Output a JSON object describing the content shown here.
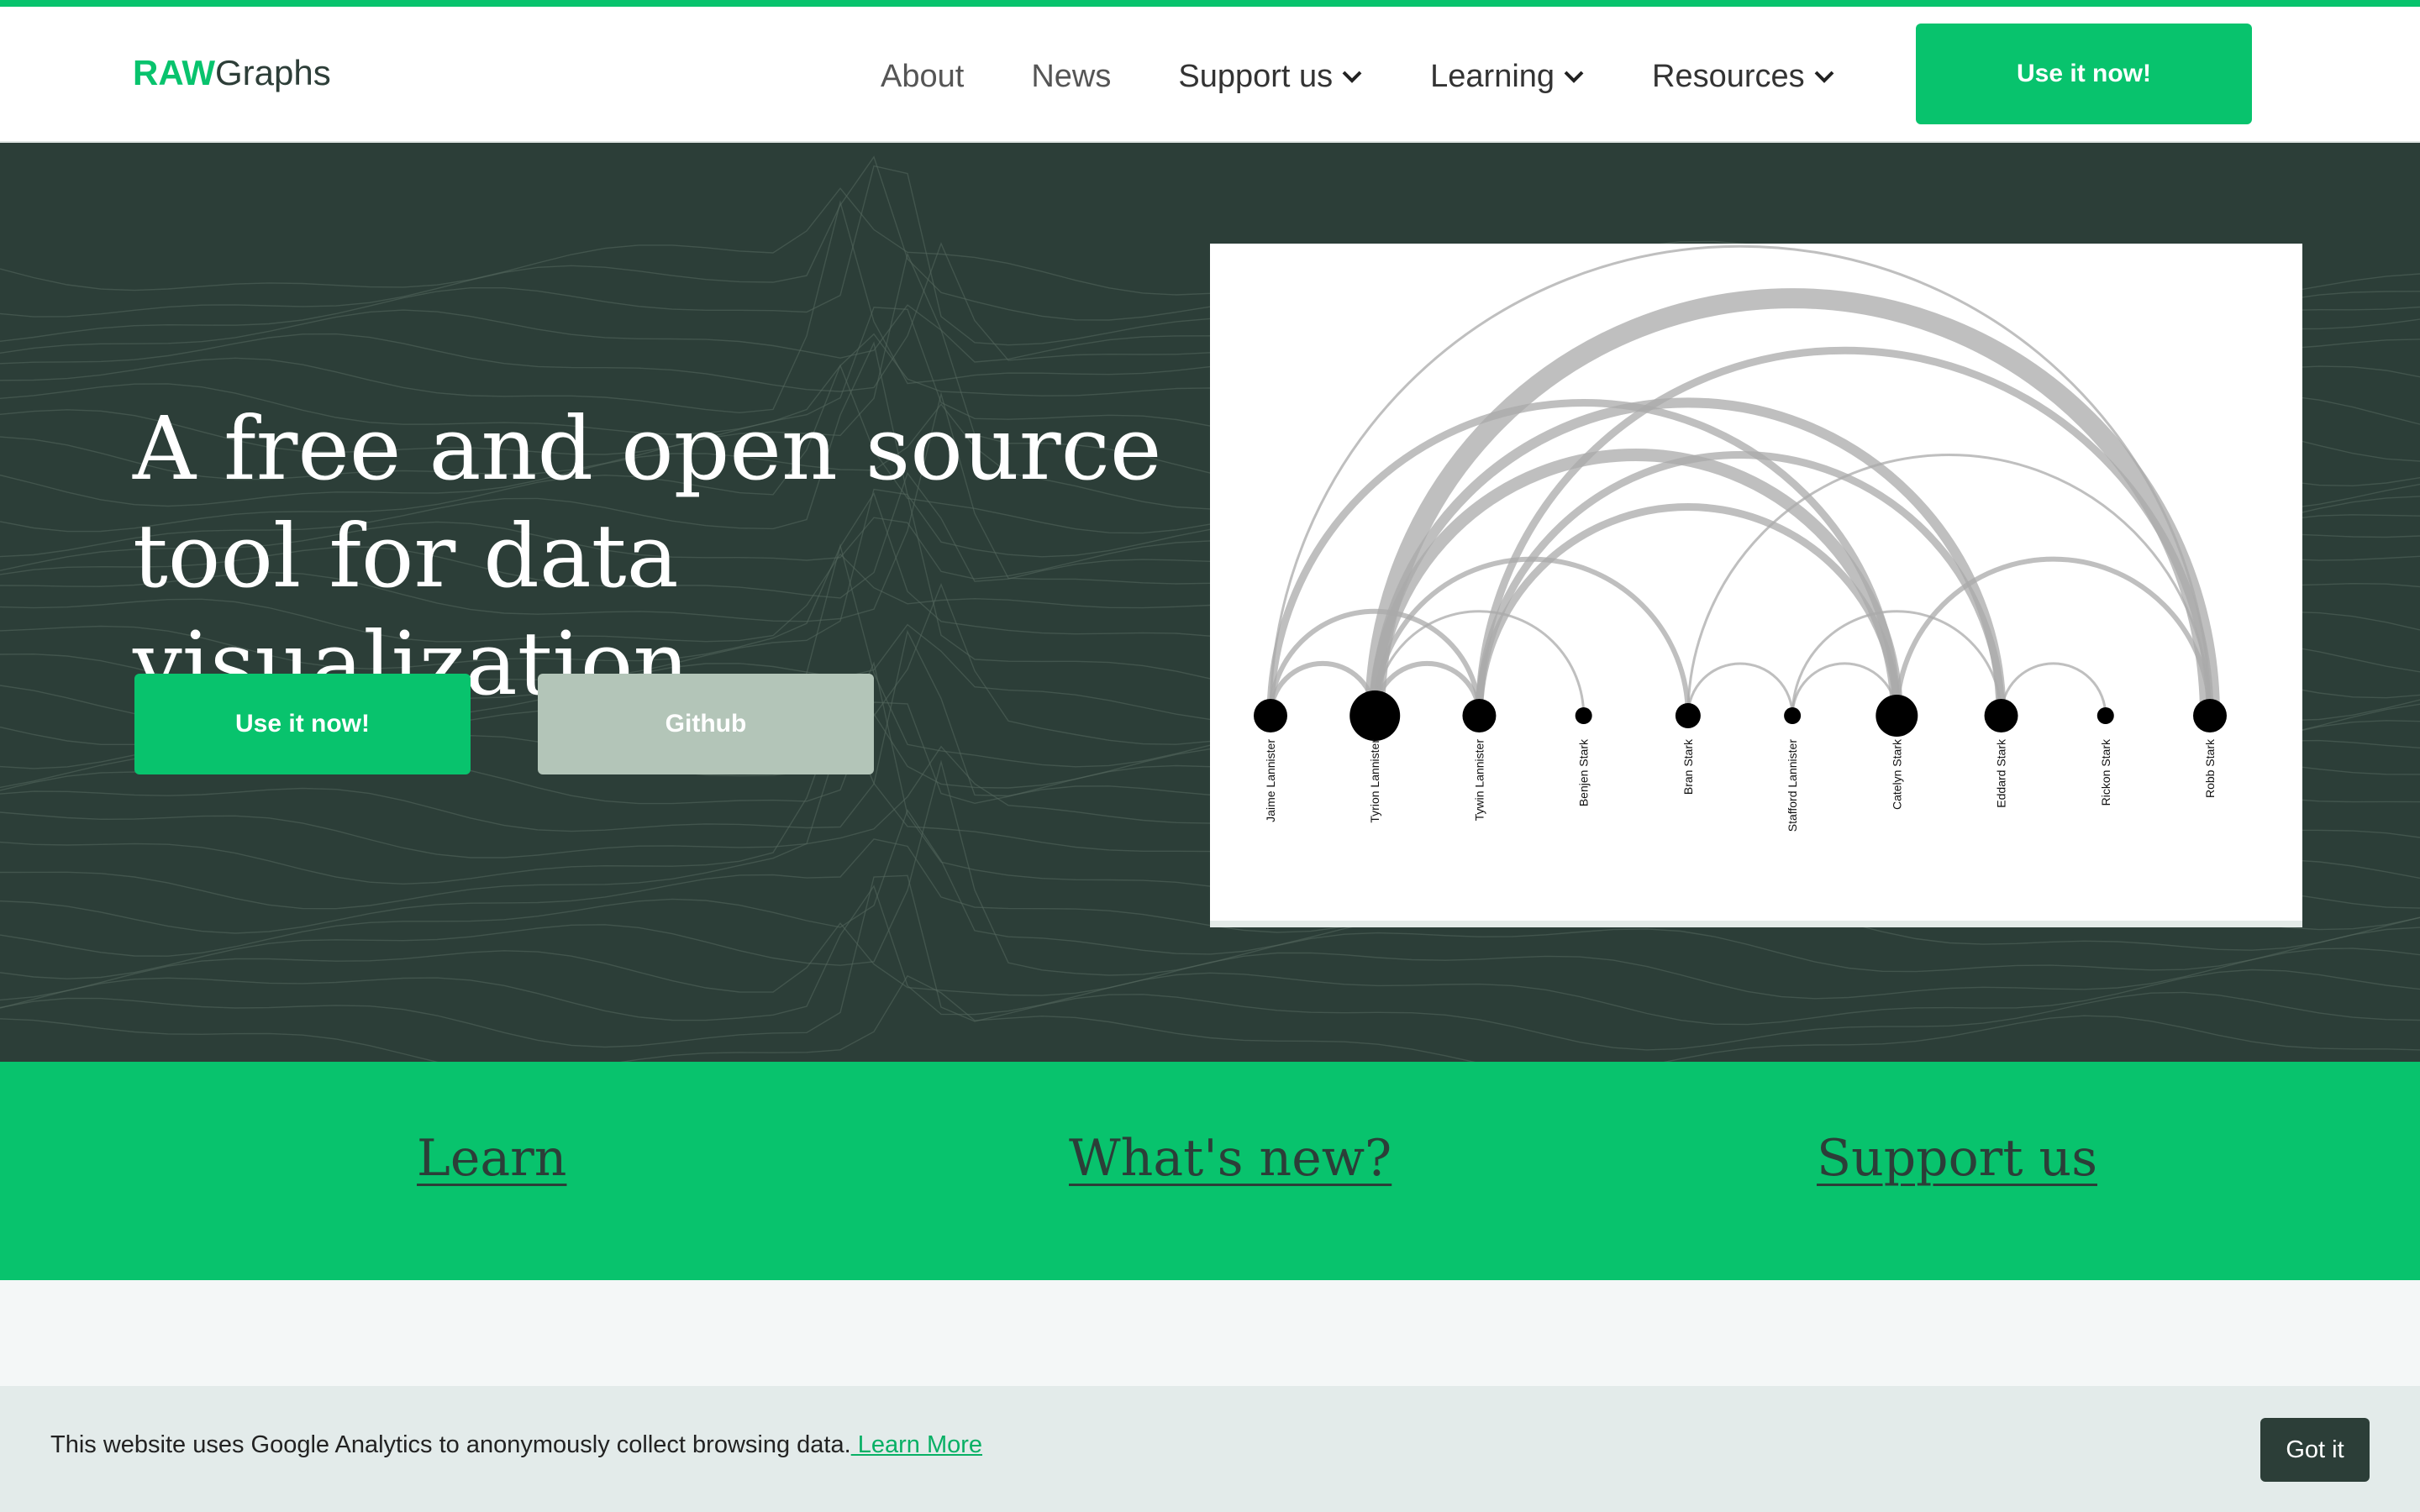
{
  "brand": {
    "logo_raw": "RAW",
    "logo_rest": "Graphs",
    "accent": "#08c36d",
    "dark": "#2c3e38"
  },
  "nav": {
    "about": "About",
    "news": "News",
    "support": "Support us",
    "learning": "Learning",
    "resources": "Resources",
    "cta": "Use it now!"
  },
  "hero": {
    "title_line1": "A free and open source",
    "title_line2": "tool for data visualization",
    "primary_btn": "Use it now!",
    "secondary_btn": "Github"
  },
  "chart_data": {
    "type": "arc",
    "nodes": [
      {
        "name": "Jaime Lannister",
        "size": 3
      },
      {
        "name": "Tyrion Lannister",
        "size": 5
      },
      {
        "name": "Tywin Lannister",
        "size": 3
      },
      {
        "name": "Benjen Stark",
        "size": 1
      },
      {
        "name": "Bran Stark",
        "size": 2
      },
      {
        "name": "Stafford Lannister",
        "size": 1
      },
      {
        "name": "Catelyn Stark",
        "size": 4
      },
      {
        "name": "Eddard Stark",
        "size": 3
      },
      {
        "name": "Rickon Stark",
        "size": 1
      },
      {
        "name": "Robb Stark",
        "size": 3
      }
    ],
    "links": [
      {
        "source": "Tyrion Lannister",
        "target": "Robb Stark",
        "weight": 8
      },
      {
        "source": "Jaime Lannister",
        "target": "Catelyn Stark",
        "weight": 3
      },
      {
        "source": "Tyrion Lannister",
        "target": "Catelyn Stark",
        "weight": 5
      },
      {
        "source": "Tywin Lannister",
        "target": "Robb Stark",
        "weight": 3
      },
      {
        "source": "Tywin Lannister",
        "target": "Eddard Stark",
        "weight": 3
      },
      {
        "source": "Tyrion Lannister",
        "target": "Eddard Stark",
        "weight": 4
      },
      {
        "source": "Jaime Lannister",
        "target": "Tywin Lannister",
        "weight": 2
      },
      {
        "source": "Tywin Lannister",
        "target": "Catelyn Stark",
        "weight": 3
      },
      {
        "source": "Tyrion Lannister",
        "target": "Bran Stark",
        "weight": 2
      },
      {
        "source": "Tyrion Lannister",
        "target": "Tywin Lannister",
        "weight": 2
      },
      {
        "source": "Tyrion Lannister",
        "target": "Benjen Stark",
        "weight": 1
      },
      {
        "source": "Jaime Lannister",
        "target": "Tyrion Lannister",
        "weight": 2
      },
      {
        "source": "Bran Stark",
        "target": "Robb Stark",
        "weight": 1
      },
      {
        "source": "Stafford Lannister",
        "target": "Catelyn Stark",
        "weight": 1
      },
      {
        "source": "Bran Stark",
        "target": "Stafford Lannister",
        "weight": 1
      },
      {
        "source": "Stafford Lannister",
        "target": "Eddard Stark",
        "weight": 1
      },
      {
        "source": "Catelyn Stark",
        "target": "Robb Stark",
        "weight": 2
      },
      {
        "source": "Eddard Stark",
        "target": "Rickon Stark",
        "weight": 1
      },
      {
        "source": "Jaime Lannister",
        "target": "Robb Stark",
        "weight": 1
      }
    ]
  },
  "band": {
    "learn": "Learn",
    "whats_new": "What's new?",
    "support": "Support us"
  },
  "cookie": {
    "text": "This website uses Google Analytics to anonymously collect browsing data.",
    "learn_more": " Learn More",
    "button": "Got it"
  }
}
